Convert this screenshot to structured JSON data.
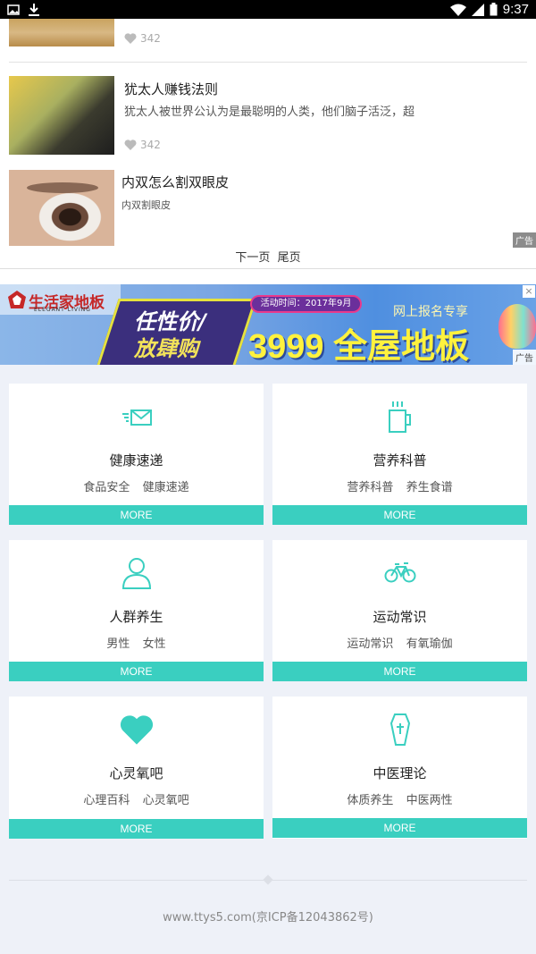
{
  "status_bar": {
    "time": "9:37",
    "icons": [
      "image-icon",
      "download-icon",
      "wifi-icon",
      "signal-icon",
      "battery-icon"
    ]
  },
  "articles": [
    {
      "likes": "342"
    },
    {
      "title": "犹太人赚钱法则",
      "desc": "犹太人被世界公认为是最聪明的人类，他们脑子活泛，超",
      "likes": "342"
    },
    {
      "title": "内双怎么割双眼皮",
      "desc": "内双割眼皮",
      "ad_tag": "广告"
    }
  ],
  "pager": {
    "next": "下一页",
    "last": "尾页"
  },
  "banner": {
    "brand": "生活家地板",
    "brand_sub": "ELEGANT LIVING",
    "slogan_line1": "任性价/",
    "slogan_line2": "放肆购",
    "date_label": "活动时间：2017年9月",
    "price_text": "3999 全屋地板",
    "signup": "网上报名专享",
    "close": "×",
    "ad_tag": "广告"
  },
  "categories": [
    {
      "icon": "envelope-icon",
      "title": "健康速递",
      "tags": [
        "食品安全",
        "健康速递"
      ],
      "more": "MORE"
    },
    {
      "icon": "cup-icon",
      "title": "营养科普",
      "tags": [
        "营养科普",
        "养生食谱"
      ],
      "more": "MORE"
    },
    {
      "icon": "person-icon",
      "title": "人群养生",
      "tags": [
        "男性",
        "女性"
      ],
      "more": "MORE"
    },
    {
      "icon": "bicycle-icon",
      "title": "运动常识",
      "tags": [
        "运动常识",
        "有氧瑜伽"
      ],
      "more": "MORE"
    },
    {
      "icon": "heart-icon",
      "title": "心灵氧吧",
      "tags": [
        "心理百科",
        "心灵氧吧"
      ],
      "more": "MORE"
    },
    {
      "icon": "coffin-icon",
      "title": "中医理论",
      "tags": [
        "体质养生",
        "中医两性"
      ],
      "more": "MORE"
    }
  ],
  "footer": "www.ttys5.com(京ICP备12043862号)",
  "colors": {
    "accent": "#3acfc0",
    "background": "#eef1f8"
  }
}
